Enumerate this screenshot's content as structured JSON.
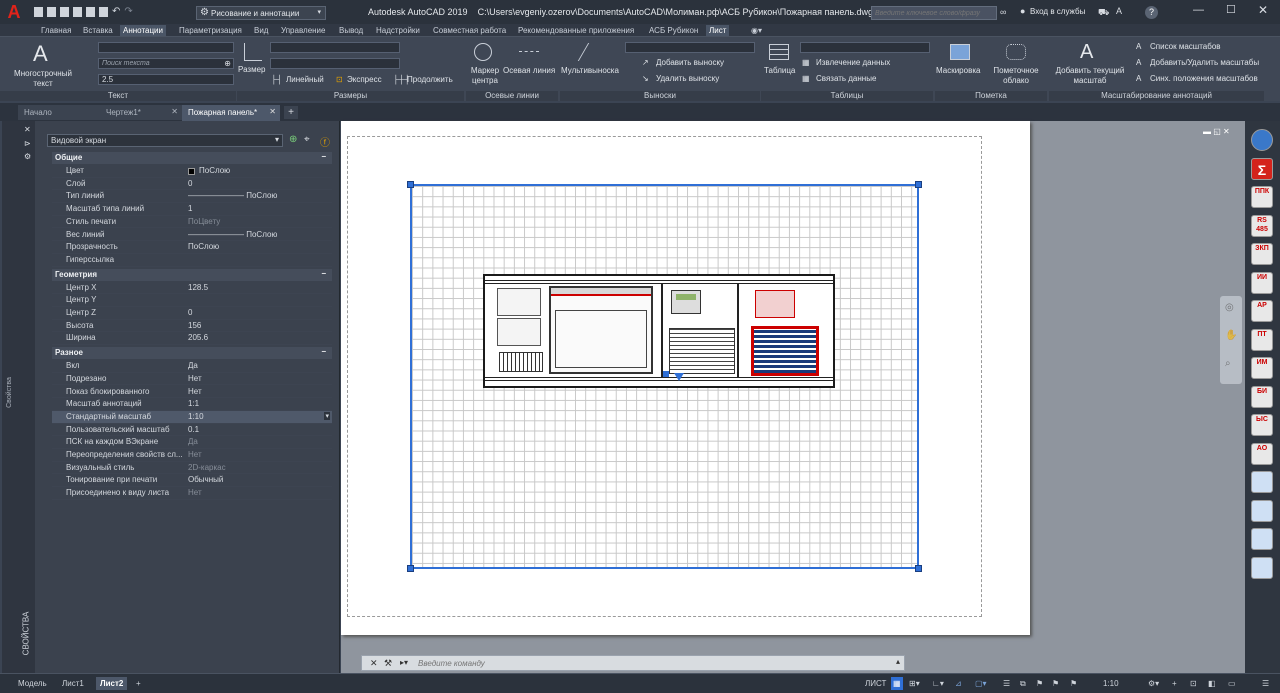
{
  "app": {
    "logo": "A",
    "title_app": "Autodesk AutoCAD 2019",
    "title_path": "C:\\Users\\evgeniy.ozerov\\Documents\\AutoCAD\\Молиман.рф\\АСБ Рубикон\\Пожарная панель.dwg",
    "workspace": "Рисование и аннотации",
    "search_placeholder": "Введите ключевое слово/фразу",
    "login": "Вход в службы",
    "help": "?"
  },
  "ribbon_tabs": [
    "Главная",
    "Вставка",
    "Аннотации",
    "Параметризация",
    "Вид",
    "Управление",
    "Вывод",
    "Надстройки",
    "Совместная работа",
    "Рекомендованные приложения",
    "АСБ Рубикон",
    "Лист"
  ],
  "ribbon": {
    "text_group": {
      "label": "Текст",
      "mtext": "Многострочный текст",
      "search_placeholder": "Поиск текста",
      "height": "2.5"
    },
    "dims_group": {
      "label": "Размеры",
      "dim": "Размер",
      "linear": "Линейный",
      "express": "Экспресс",
      "continue": "Продолжить"
    },
    "center_group": {
      "label": "Осевые линии",
      "marker": "Маркер центра",
      "axis": "Осевая линия"
    },
    "leaders_group": {
      "label": "Выноски",
      "multileader": "Мультивыноска",
      "add": "Добавить выноску",
      "remove": "Удалить выноску"
    },
    "tables_group": {
      "label": "Таблицы",
      "table": "Таблица",
      "extract": "Извлечение данных",
      "link": "Связать данные"
    },
    "markup_group": {
      "label": "Пометка",
      "wipeout": "Маскировка",
      "cloud": "Пометочное облако"
    },
    "scale_group": {
      "label": "Масштабирование аннотаций",
      "add_scale": "Добавить текущий масштаб",
      "list": "Список масштабов",
      "add_remove": "Добавить/Удалить масштабы",
      "sync": "Синх. положения масштабов"
    }
  },
  "doc_tabs": [
    "Начало",
    "Чертеж1*",
    "Пожарная панель*"
  ],
  "properties": {
    "panel_title": "СВОЙСТВА",
    "side_label": "Свойства",
    "selector": "Видовой экран",
    "sections": [
      {
        "title": "Общие",
        "rows": [
          {
            "k": "Цвет",
            "v": "ПоСлою"
          },
          {
            "k": "Слой",
            "v": "0"
          },
          {
            "k": "Тип линий",
            "v": "——————— ПоСлою"
          },
          {
            "k": "Масштаб типа линий",
            "v": "1"
          },
          {
            "k": "Стиль печати",
            "v": "ПоЦвету"
          },
          {
            "k": "Вес линий",
            "v": "——————— ПоСлою"
          },
          {
            "k": "Прозрачность",
            "v": "ПоСлою"
          },
          {
            "k": "Гиперссылка",
            "v": ""
          }
        ]
      },
      {
        "title": "Геометрия",
        "rows": [
          {
            "k": "Центр X",
            "v": "128.5"
          },
          {
            "k": "Центр Y",
            "v": ""
          },
          {
            "k": "Центр Z",
            "v": "0"
          },
          {
            "k": "Высота",
            "v": "156"
          },
          {
            "k": "Ширина",
            "v": "205.6"
          }
        ]
      },
      {
        "title": "Разное",
        "rows": [
          {
            "k": "Вкл",
            "v": "Да"
          },
          {
            "k": "Подрезано",
            "v": "Нет"
          },
          {
            "k": "Показ блокированного",
            "v": "Нет"
          },
          {
            "k": "Масштаб аннотаций",
            "v": "1:1"
          },
          {
            "k": "Стандартный масштаб",
            "v": "1:10"
          },
          {
            "k": "Пользовательский масштаб",
            "v": "0.1"
          },
          {
            "k": "ПСК на каждом ВЭкране",
            "v": "Да"
          },
          {
            "k": "Переопределения свойств сл...",
            "v": "Нет"
          },
          {
            "k": "Визуальный стиль",
            "v": "2D-каркас"
          },
          {
            "k": "Тонирование при печати",
            "v": "Обычный"
          },
          {
            "k": "Присоединено к виду листа",
            "v": "Нет"
          }
        ]
      }
    ]
  },
  "command_placeholder": "Введите команду",
  "layout_tabs": [
    "Модель",
    "Лист1",
    "Лист2"
  ],
  "status": {
    "mode": "ЛИСТ",
    "scale": "1:10"
  },
  "right_tools": [
    {
      "name": "globe-icon",
      "label": ""
    },
    {
      "name": "sigma-icon",
      "label": "Σ"
    },
    {
      "name": "ppk-icon",
      "label": "ППК"
    },
    {
      "name": "rs485-icon",
      "label": "RS 485"
    },
    {
      "name": "zkp-icon",
      "label": "ЗКП"
    },
    {
      "name": "ii-icon",
      "label": "ИИ"
    },
    {
      "name": "ar-icon",
      "label": "АР"
    },
    {
      "name": "pt-icon",
      "label": "ПТ"
    },
    {
      "name": "im-icon",
      "label": "ИМ"
    },
    {
      "name": "bi-icon",
      "label": "БИ"
    },
    {
      "name": "ys-icon",
      "label": "ЫС"
    },
    {
      "name": "ao-icon",
      "label": "АО"
    },
    {
      "name": "book-icon",
      "label": ""
    },
    {
      "name": "tool-icon",
      "label": ""
    },
    {
      "name": "hand-icon",
      "label": ""
    },
    {
      "name": "refresh-icon",
      "label": ""
    }
  ]
}
